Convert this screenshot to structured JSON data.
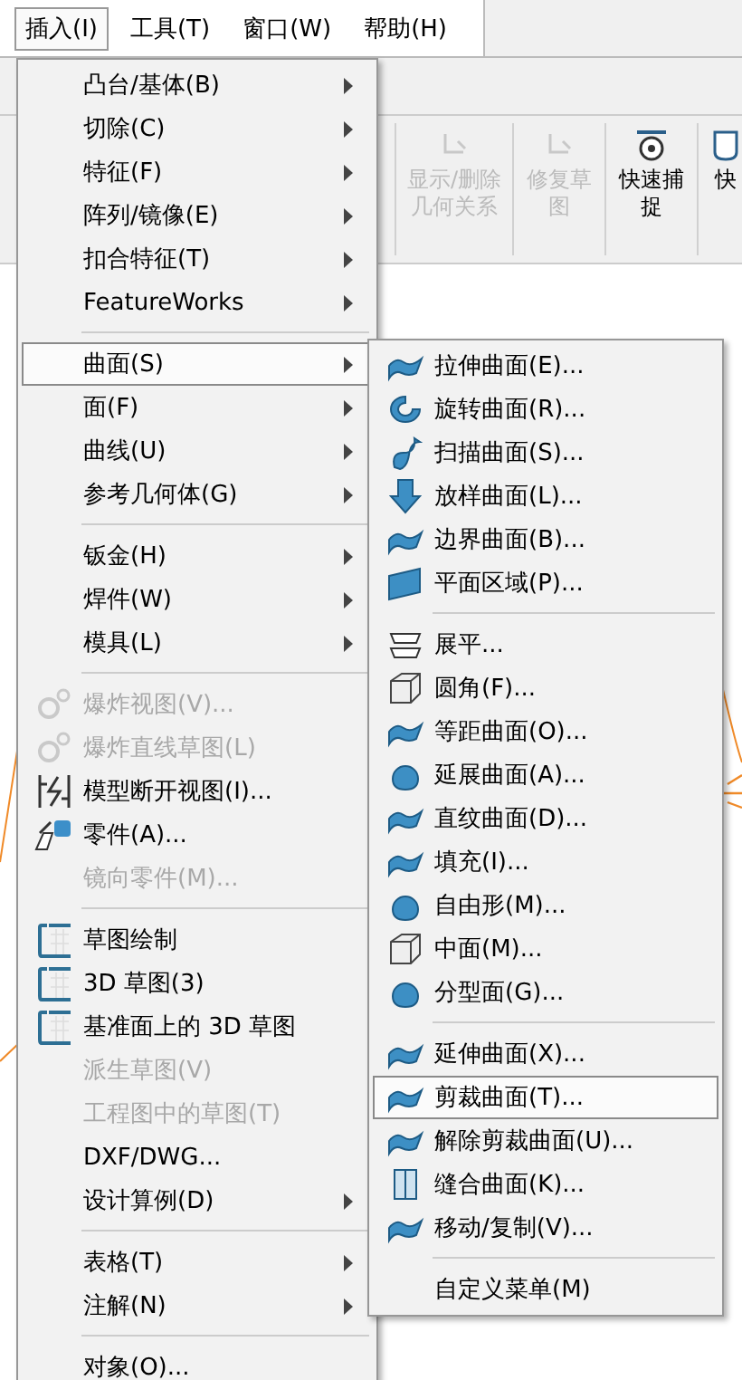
{
  "menubar": {
    "items": [
      {
        "label": "插入(I)",
        "selected": true
      },
      {
        "label": "工具(T)",
        "selected": false
      },
      {
        "label": "窗口(W)",
        "selected": false
      },
      {
        "label": "帮助(H)",
        "selected": false
      }
    ]
  },
  "toolbar": {
    "buttons": [
      {
        "label": "显示/删除几何关系",
        "disabled": true
      },
      {
        "label": "修复草图",
        "disabled": true
      },
      {
        "label": "快速捕捉",
        "disabled": false
      },
      {
        "label": "快",
        "disabled": false
      }
    ]
  },
  "menu": {
    "items": [
      {
        "kind": "item",
        "label": "凸台/基体(B)",
        "submenu": true,
        "disabled": false,
        "selected": false
      },
      {
        "kind": "item",
        "label": "切除(C)",
        "submenu": true,
        "disabled": false,
        "selected": false
      },
      {
        "kind": "item",
        "label": "特征(F)",
        "submenu": true,
        "disabled": false,
        "selected": false
      },
      {
        "kind": "item",
        "label": "阵列/镜像(E)",
        "submenu": true,
        "disabled": false,
        "selected": false
      },
      {
        "kind": "item",
        "label": "扣合特征(T)",
        "submenu": true,
        "disabled": false,
        "selected": false
      },
      {
        "kind": "item",
        "label": "FeatureWorks",
        "submenu": true,
        "disabled": false,
        "selected": false
      },
      {
        "kind": "separator"
      },
      {
        "kind": "item",
        "label": "曲面(S)",
        "submenu": true,
        "disabled": false,
        "selected": true
      },
      {
        "kind": "item",
        "label": "面(F)",
        "submenu": true,
        "disabled": false,
        "selected": false
      },
      {
        "kind": "item",
        "label": "曲线(U)",
        "submenu": true,
        "disabled": false,
        "selected": false
      },
      {
        "kind": "item",
        "label": "参考几何体(G)",
        "submenu": true,
        "disabled": false,
        "selected": false
      },
      {
        "kind": "separator"
      },
      {
        "kind": "item",
        "label": "钣金(H)",
        "submenu": true,
        "disabled": false,
        "selected": false
      },
      {
        "kind": "item",
        "label": "焊件(W)",
        "submenu": true,
        "disabled": false,
        "selected": false
      },
      {
        "kind": "item",
        "label": "模具(L)",
        "submenu": true,
        "disabled": false,
        "selected": false
      },
      {
        "kind": "separator"
      },
      {
        "kind": "item",
        "label": "爆炸视图(V)...",
        "submenu": false,
        "disabled": true,
        "selected": false
      },
      {
        "kind": "item",
        "label": "爆炸直线草图(L)",
        "submenu": false,
        "disabled": true,
        "selected": false
      },
      {
        "kind": "item",
        "label": "模型断开视图(I)...",
        "submenu": false,
        "disabled": false,
        "selected": false
      },
      {
        "kind": "item",
        "label": "零件(A)...",
        "submenu": false,
        "disabled": false,
        "selected": false
      },
      {
        "kind": "item",
        "label": "镜向零件(M)...",
        "submenu": false,
        "disabled": true,
        "selected": false
      },
      {
        "kind": "separator"
      },
      {
        "kind": "item",
        "label": "草图绘制",
        "submenu": false,
        "disabled": false,
        "selected": false
      },
      {
        "kind": "item",
        "label": "3D 草图(3)",
        "submenu": false,
        "disabled": false,
        "selected": false
      },
      {
        "kind": "item",
        "label": "基准面上的 3D 草图",
        "submenu": false,
        "disabled": false,
        "selected": false
      },
      {
        "kind": "item",
        "label": "派生草图(V)",
        "submenu": false,
        "disabled": true,
        "selected": false
      },
      {
        "kind": "item",
        "label": "工程图中的草图(T)",
        "submenu": false,
        "disabled": true,
        "selected": false
      },
      {
        "kind": "item",
        "label": "DXF/DWG...",
        "submenu": false,
        "disabled": false,
        "selected": false
      },
      {
        "kind": "item",
        "label": "设计算例(D)",
        "submenu": true,
        "disabled": false,
        "selected": false
      },
      {
        "kind": "separator"
      },
      {
        "kind": "item",
        "label": "表格(T)",
        "submenu": true,
        "disabled": false,
        "selected": false
      },
      {
        "kind": "item",
        "label": "注解(N)",
        "submenu": true,
        "disabled": false,
        "selected": false
      },
      {
        "kind": "separator"
      },
      {
        "kind": "item",
        "label": "对象(O)...",
        "submenu": false,
        "disabled": false,
        "selected": false
      }
    ]
  },
  "submenu": {
    "items": [
      {
        "kind": "item",
        "label": "拉伸曲面(E)...",
        "selected": false
      },
      {
        "kind": "item",
        "label": "旋转曲面(R)...",
        "selected": false
      },
      {
        "kind": "item",
        "label": "扫描曲面(S)...",
        "selected": false
      },
      {
        "kind": "item",
        "label": "放样曲面(L)...",
        "selected": false
      },
      {
        "kind": "item",
        "label": "边界曲面(B)...",
        "selected": false
      },
      {
        "kind": "item",
        "label": "平面区域(P)...",
        "selected": false
      },
      {
        "kind": "separator"
      },
      {
        "kind": "item",
        "label": "展平...",
        "selected": false
      },
      {
        "kind": "item",
        "label": "圆角(F)...",
        "selected": false
      },
      {
        "kind": "item",
        "label": "等距曲面(O)...",
        "selected": false
      },
      {
        "kind": "item",
        "label": "延展曲面(A)...",
        "selected": false
      },
      {
        "kind": "item",
        "label": "直纹曲面(D)...",
        "selected": false
      },
      {
        "kind": "item",
        "label": "填充(I)...",
        "selected": false
      },
      {
        "kind": "item",
        "label": "自由形(M)...",
        "selected": false
      },
      {
        "kind": "item",
        "label": "中面(M)...",
        "selected": false
      },
      {
        "kind": "item",
        "label": "分型面(G)...",
        "selected": false
      },
      {
        "kind": "separator"
      },
      {
        "kind": "item",
        "label": "延伸曲面(X)...",
        "selected": false
      },
      {
        "kind": "item",
        "label": "剪裁曲面(T)...",
        "selected": true
      },
      {
        "kind": "item",
        "label": "解除剪裁曲面(U)...",
        "selected": false
      },
      {
        "kind": "item",
        "label": "缝合曲面(K)...",
        "selected": false
      },
      {
        "kind": "item",
        "label": "移动/复制(V)...",
        "selected": false
      },
      {
        "kind": "separator"
      },
      {
        "kind": "item",
        "label": "自定义菜单(M)",
        "selected": false
      }
    ]
  }
}
